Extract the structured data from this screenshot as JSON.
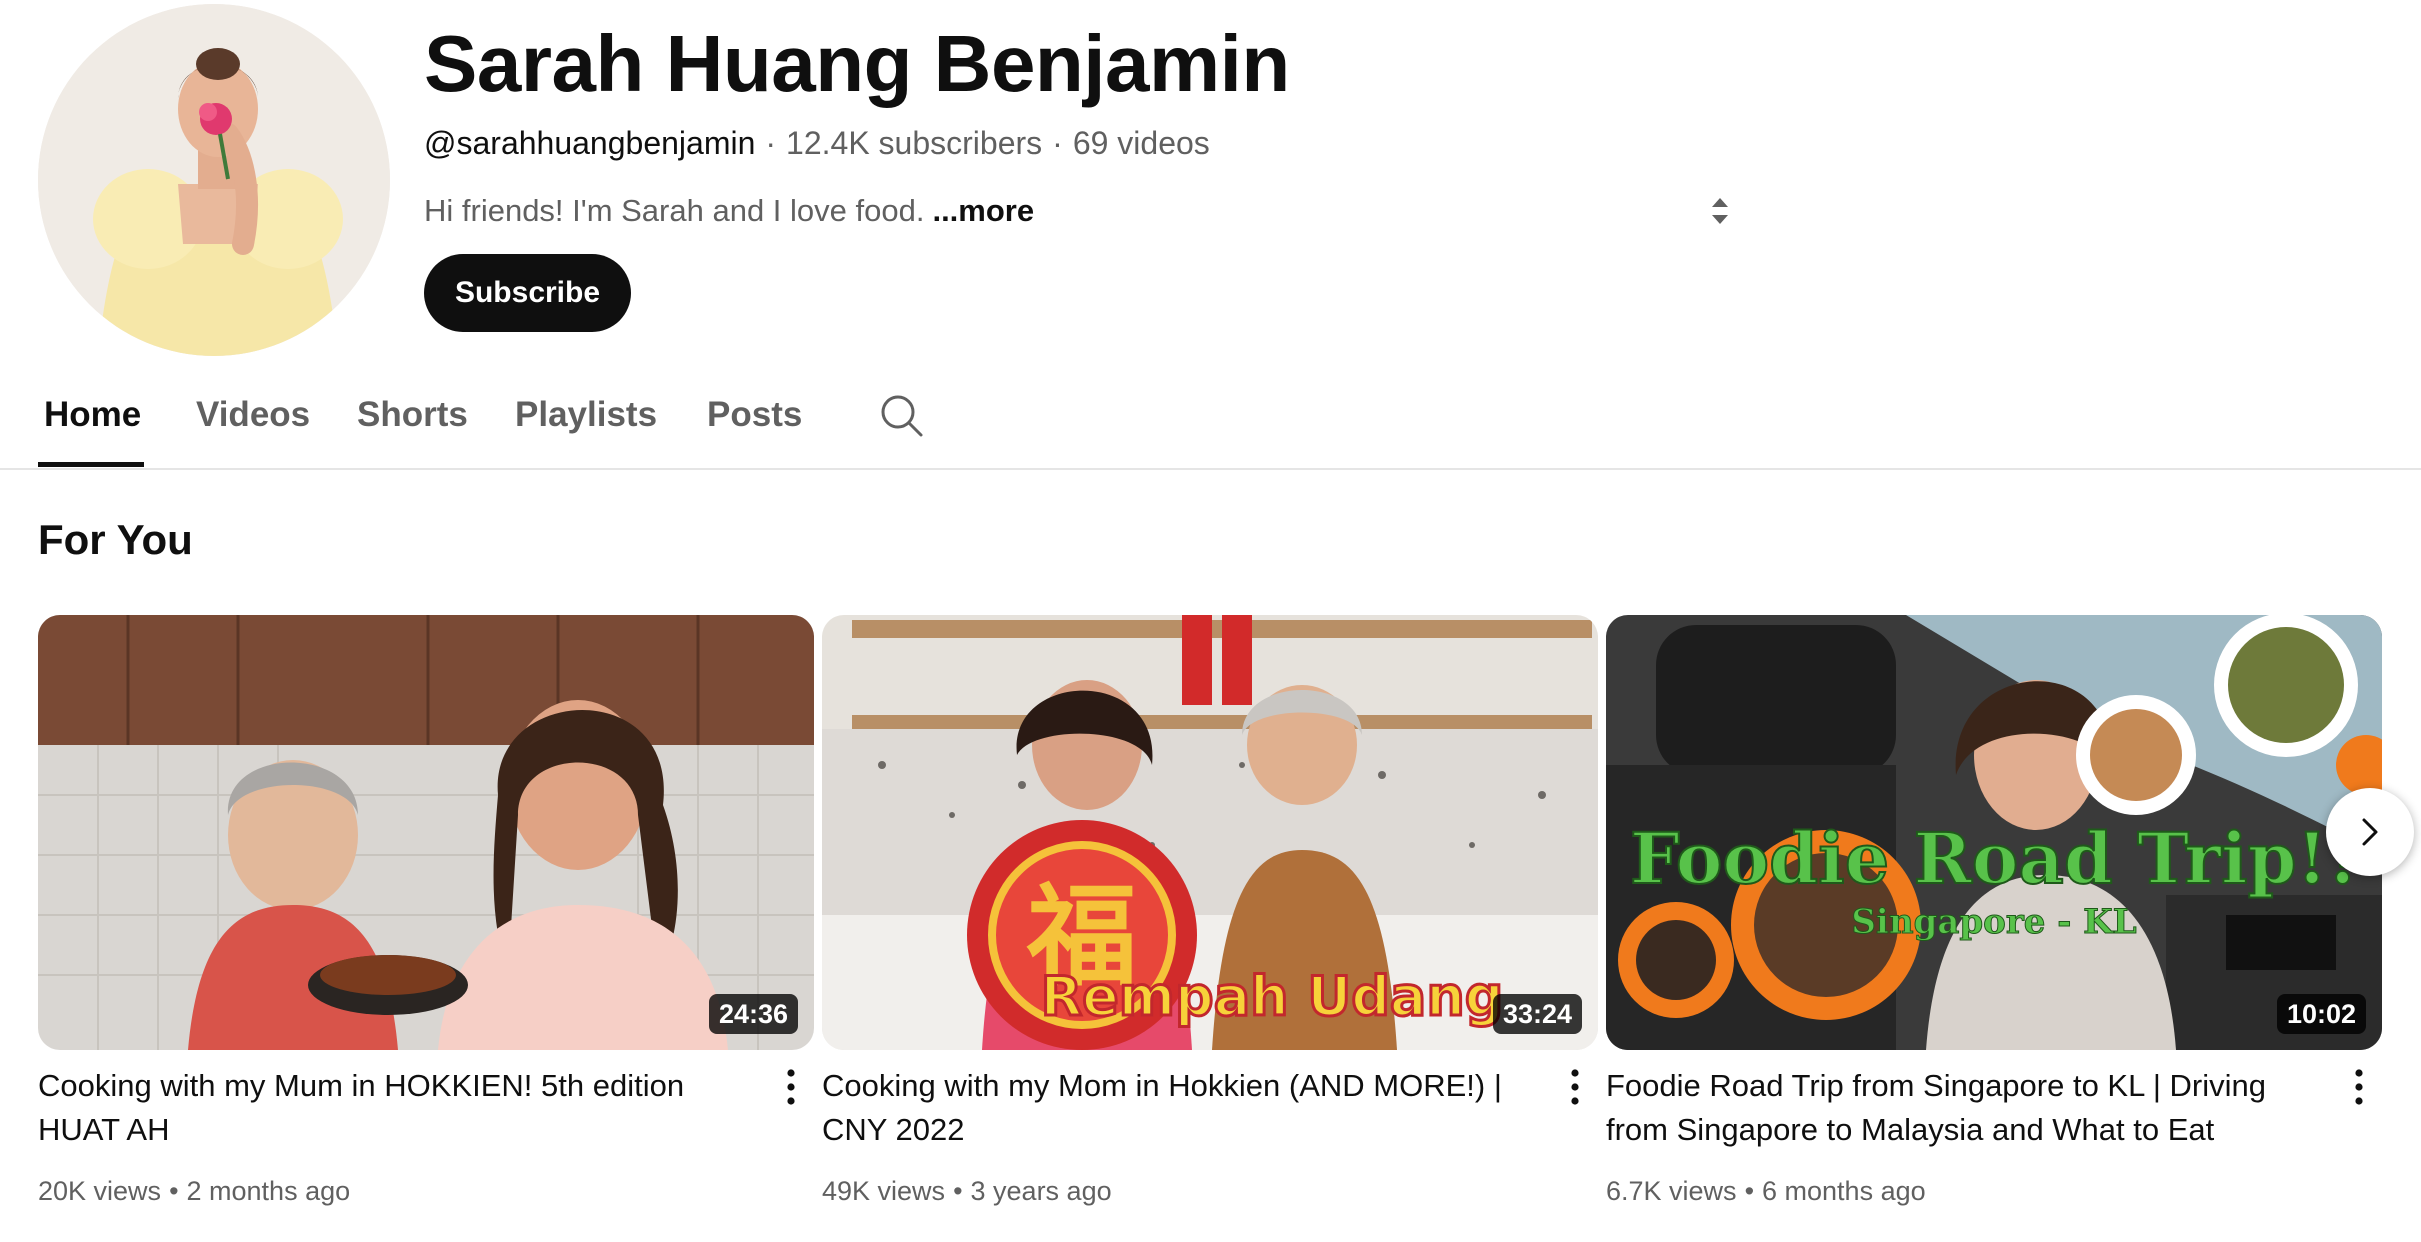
{
  "channel": {
    "name": "Sarah Huang Benjamin",
    "handle": "@sarahhuangbenjamin",
    "subscribers": "12.4K subscribers",
    "videos": "69 videos",
    "separator": "·",
    "description": "Hi friends! I'm Sarah and I love food.",
    "more_label": "...more",
    "subscribe_label": "Subscribe"
  },
  "tabs": [
    {
      "label": "Home",
      "active": true
    },
    {
      "label": "Videos",
      "active": false
    },
    {
      "label": "Shorts",
      "active": false
    },
    {
      "label": "Playlists",
      "active": false
    },
    {
      "label": "Posts",
      "active": false
    }
  ],
  "section": {
    "title": "For You",
    "videos": [
      {
        "title": "Cooking with my Mum in HOKKIEN! 5th edition HUAT AH",
        "duration": "24:36",
        "views": "20K views",
        "age": "2 months ago"
      },
      {
        "title": "Cooking with my Mom in Hokkien (AND MORE!) | CNY 2022",
        "duration": "33:24",
        "views": "49K views",
        "age": "3 years ago",
        "thumb_text": "Rempah Udang",
        "thumb_char": "福"
      },
      {
        "title": "Foodie Road Trip from Singapore to KL | Driving from Singapore to Malaysia and What to Eat",
        "duration": "10:02",
        "views": "6.7K views",
        "age": "6 months ago",
        "thumb_text": "Foodie Road Trip!!",
        "thumb_subtext": "Singapore - KL"
      }
    ]
  },
  "icons": {
    "search": "search-icon",
    "more_vert": "more-vertical-icon",
    "next": "chevron-right-icon",
    "expand": "expand-arrows-icon"
  },
  "colors": {
    "text_primary": "#0f0f0f",
    "text_secondary": "#606060",
    "subscribe_bg": "#0f0f0f"
  }
}
